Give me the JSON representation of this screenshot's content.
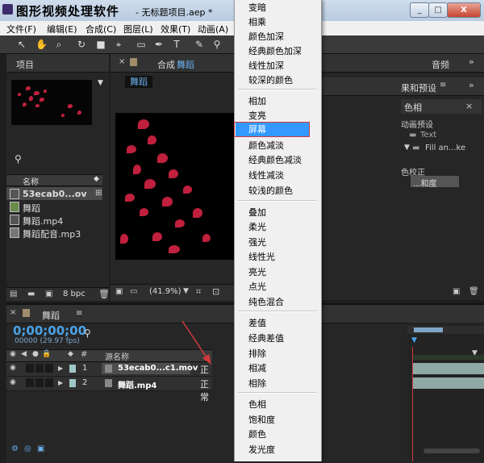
{
  "window": {
    "app_title": "图形视频处理软件",
    "file_title": "- 无标题项目.aep *",
    "buttons": [
      "_",
      "□",
      "X"
    ]
  },
  "menubar": {
    "items": [
      "文件(F)",
      "编辑(E)",
      "合成(C)",
      "图层(L)",
      "效果(T)",
      "动画(A)"
    ]
  },
  "project_panel": {
    "tab_label": "项目",
    "column_name": "名称",
    "items": [
      {
        "label": "53ecab0...ov",
        "selected": true
      },
      {
        "label": "舞蹈",
        "selected": false
      },
      {
        "label": "舞蹈.mp4",
        "selected": false
      },
      {
        "label": "舞蹈配音.mp3",
        "selected": false
      }
    ],
    "bit_depth": "8 bpc"
  },
  "comp_panel": {
    "tab_prefix": "合成",
    "tab_name": "舞蹈",
    "breadcrumb": "舞蹈",
    "zoom": "(41.9%)"
  },
  "right_panel": {
    "tab_audio": "音频",
    "tab_effects": "果和预设",
    "hue_label": "色相",
    "anim_presets": "动画预设",
    "text_item": "Text",
    "fill_item": "Fill an...ke",
    "color_correct": "色校正",
    "saturation_item": "...和度"
  },
  "timeline": {
    "tab_name": "舞蹈",
    "timecode": "0;00;00;00",
    "fps": "00000 (29.97 fps)",
    "col_num": "#",
    "col_source": "源名称",
    "layers": [
      {
        "num": "1",
        "name": "53ecab0...c1.mov",
        "mode": "正常"
      },
      {
        "num": "2",
        "name": "舞蹈.mp4",
        "mode": "正常"
      }
    ]
  },
  "blend_menu": {
    "groups": [
      [
        "变暗",
        "相乘",
        "颜色加深",
        "经典颜色加深",
        "线性加深",
        "较深的颜色"
      ],
      [
        "相加",
        "变亮",
        "屏幕",
        "颜色减淡",
        "经典颜色减淡",
        "线性减淡",
        "较浅的颜色"
      ],
      [
        "叠加",
        "柔光",
        "强光",
        "线性光",
        "亮光",
        "点光",
        "纯色混合"
      ],
      [
        "差值",
        "经典差值",
        "排除",
        "相减",
        "相除"
      ],
      [
        "色相",
        "饱和度",
        "颜色",
        "发光度"
      ]
    ],
    "highlighted": "屏幕"
  },
  "colors": {
    "highlight": "#3399ff",
    "annotation": "#d23a3a",
    "timecode": "#4aa3e8"
  }
}
